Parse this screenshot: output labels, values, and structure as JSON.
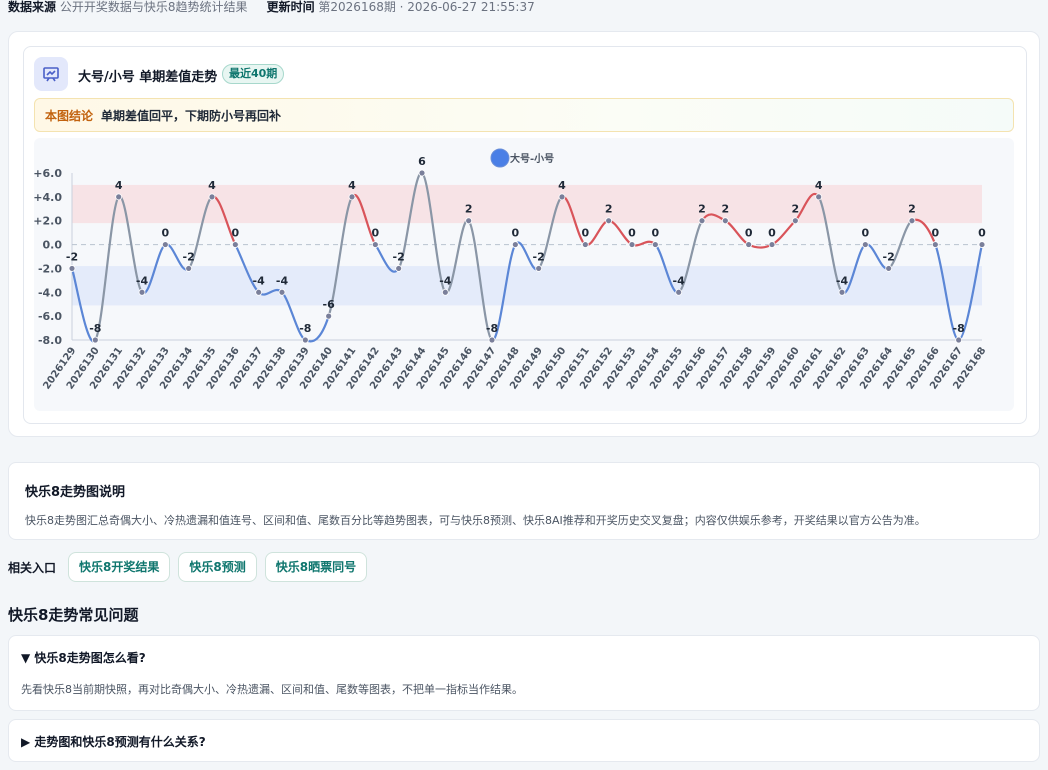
{
  "header": {
    "source_label": "数据来源",
    "source_value": "公开开奖数据与快乐8趋势统计结果",
    "update_label": "更新时间",
    "update_value": "第2026168期 · 2026-06-27 21:55:37"
  },
  "card": {
    "title": "大号/小号 单期差值走势",
    "badge": "最近40期",
    "conclusion_label": "本图结论",
    "conclusion_text": "单期差值回平，下期防小号再回补"
  },
  "chart_data": {
    "type": "line",
    "series": [
      {
        "name": "大号-小号",
        "values": [
          -2,
          -8,
          4,
          -4,
          0,
          -2,
          4,
          0,
          -4,
          -4,
          -8,
          -6,
          4,
          0,
          -2,
          6,
          -4,
          2,
          -8,
          0,
          -2,
          4,
          0,
          2,
          0,
          0,
          -4,
          2,
          2,
          0,
          0,
          2,
          4,
          -4,
          0,
          -2,
          2,
          0,
          -8,
          0
        ]
      }
    ],
    "categories": [
      "2026129",
      "2026130",
      "2026131",
      "2026132",
      "2026133",
      "2026134",
      "2026135",
      "2026136",
      "2026137",
      "2026138",
      "2026139",
      "2026140",
      "2026141",
      "2026142",
      "2026143",
      "2026144",
      "2026145",
      "2026146",
      "2026147",
      "2026148",
      "2026149",
      "2026150",
      "2026151",
      "2026152",
      "2026153",
      "2026154",
      "2026155",
      "2026156",
      "2026157",
      "2026158",
      "2026159",
      "2026160",
      "2026161",
      "2026162",
      "2026163",
      "2026164",
      "2026165",
      "2026166",
      "2026167",
      "2026168"
    ],
    "y_ticks": [
      "+6.0",
      "+4.0",
      "+2.0",
      "0.0",
      "-2.0",
      "-4.0",
      "-6.0",
      "-8.0"
    ],
    "ylim": [
      -8,
      6
    ],
    "bands": [
      {
        "name": "upper",
        "from": 1.8,
        "to": 5.0,
        "color": "#f7e3e6"
      },
      {
        "name": "lower",
        "from": -5.1,
        "to": -1.8,
        "color": "#e4ebfa"
      }
    ],
    "colors": {
      "positive": "#d9545a",
      "negative": "#5b86d6",
      "neutral": "#8a96a6",
      "legend": "#4a7fe6"
    }
  },
  "about": {
    "title": "快乐8走势图说明",
    "text": "快乐8走势图汇总奇偶大小、冷热遗漏和值连号、区间和值、尾数百分比等趋势图表，可与快乐8预测、快乐8AI推荐和开奖历史交叉复盘；内容仅供娱乐参考，开奖结果以官方公告为准。"
  },
  "related": {
    "label": "相关入口",
    "links": [
      "快乐8开奖结果",
      "快乐8预测",
      "快乐8晒票同号"
    ]
  },
  "faq": {
    "title": "快乐8走势常见问题",
    "items": [
      {
        "q": "▼ 快乐8走势图怎么看?",
        "a": "先看快乐8当前期快照，再对比奇偶大小、冷热遗漏、区间和值、尾数等图表，不把单一指标当作结果。"
      },
      {
        "q": "▶ 走势图和快乐8预测有什么关系?"
      }
    ]
  }
}
